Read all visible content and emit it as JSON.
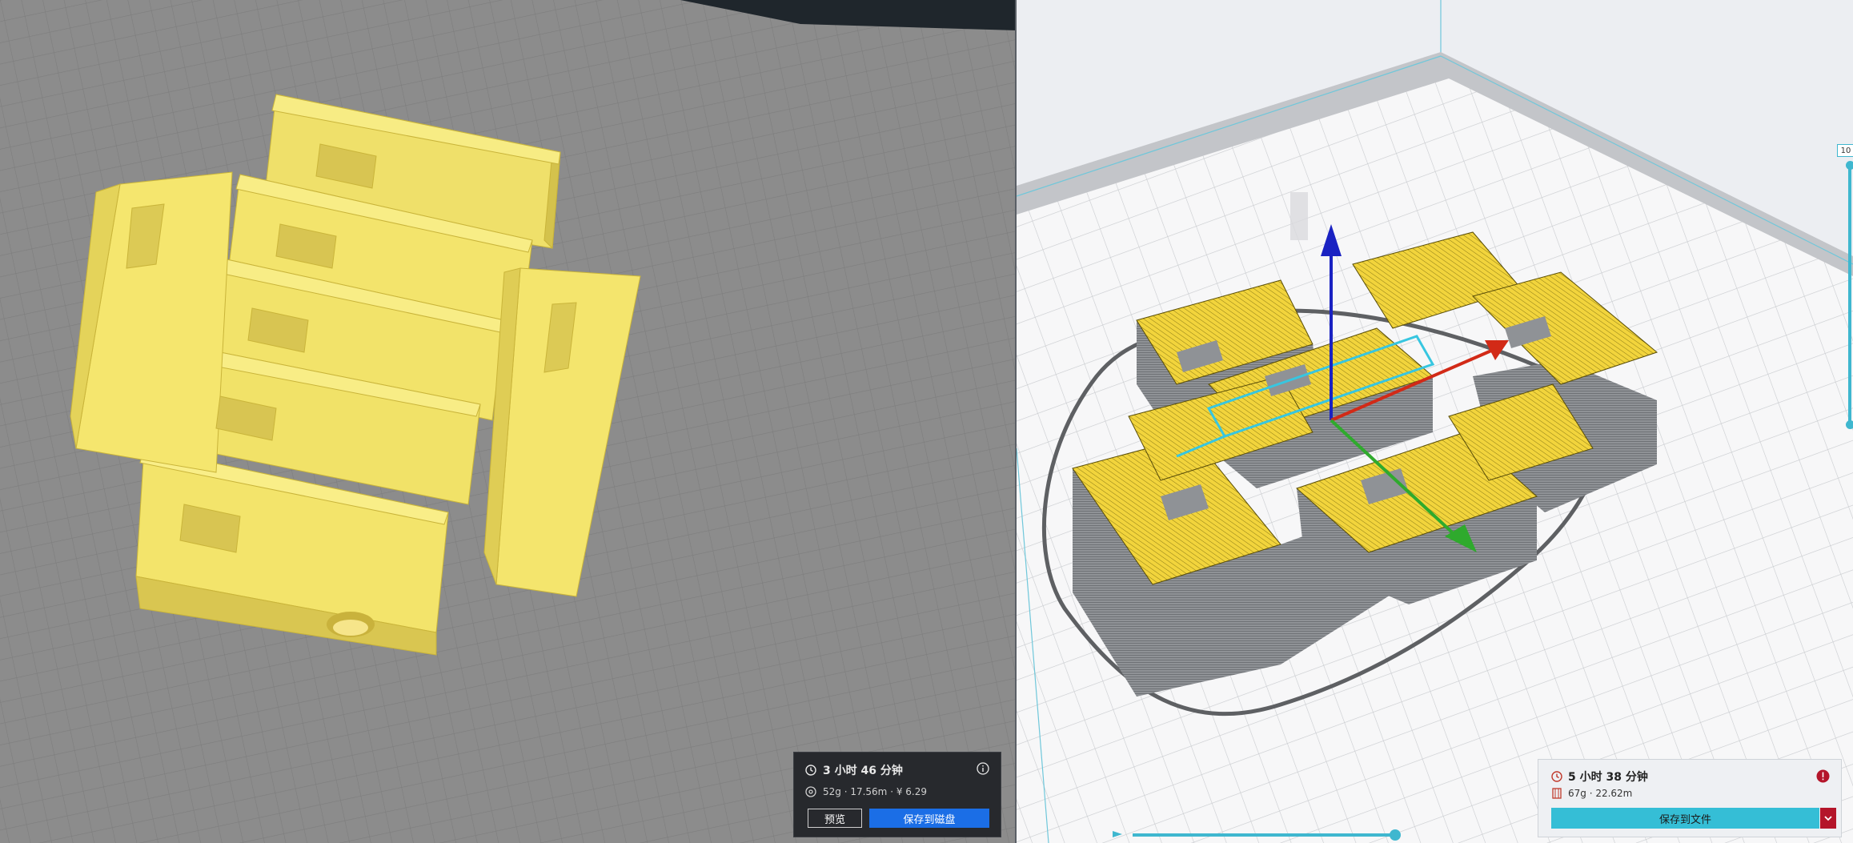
{
  "left_summary": {
    "print_time": "3 小时 46 分钟",
    "material": "52g · 17.56m · ¥ 6.29",
    "preview_label": "预览",
    "save_label": "保存到磁盘"
  },
  "right_summary": {
    "print_time": "5 小时 38 分钟",
    "material": "67g · 22.62m",
    "save_label": "保存到文件"
  },
  "layer_slider": {
    "value_label": "10"
  },
  "colors": {
    "model_yellow": "#f6e96a",
    "accent_blue": "#1b6ee6",
    "accent_cyan": "#35bed6",
    "alert_red": "#b4152a"
  },
  "icons": [
    "clock-icon",
    "spool-icon",
    "info-icon",
    "alert-icon",
    "chevron-down-icon",
    "play-icon"
  ]
}
